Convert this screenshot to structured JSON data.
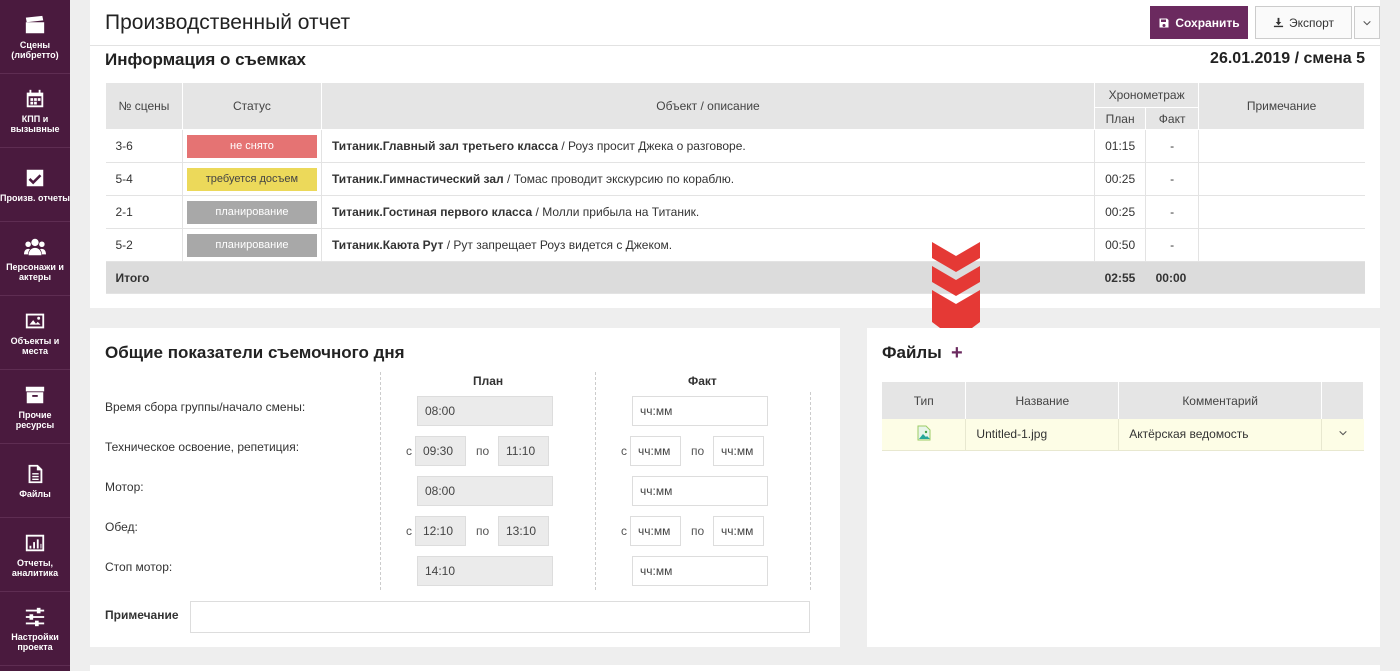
{
  "sidebar": {
    "items": [
      {
        "label": "Сцены (либретто)",
        "icon": "clapperboard-icon"
      },
      {
        "label": "КПП и вызывные",
        "icon": "calendar-icon"
      },
      {
        "label": "Произв. отчеты",
        "icon": "checkbox-icon"
      },
      {
        "label": "Персонажи и актеры",
        "icon": "people-icon"
      },
      {
        "label": "Объекты и места",
        "icon": "image-icon"
      },
      {
        "label": "Прочие ресурсы",
        "icon": "box-icon"
      },
      {
        "label": "Файлы",
        "icon": "file-icon"
      },
      {
        "label": "Отчеты, аналитика",
        "icon": "chart-icon"
      },
      {
        "label": "Настройки проекта",
        "icon": "sliders-icon"
      }
    ]
  },
  "header": {
    "title": "Производственный отчет",
    "save_label": "Сохранить",
    "export_label": "Экспорт"
  },
  "info": {
    "title": "Информация о съемках",
    "date": "26.01.2019 / смена 5",
    "columns": {
      "scene_no": "№ сцены",
      "status": "Статус",
      "object": "Объект / описание",
      "timing": "Хронометраж",
      "plan": "План",
      "fact": "Факт",
      "note": "Примечание"
    },
    "rows": [
      {
        "scene": "3-6",
        "status": "не снято",
        "status_color": "#e57373",
        "object": "Титаник.Главный зал третьего класса",
        "desc": "Роуз просит Джека о разговоре.",
        "plan": "01:15",
        "fact": "-"
      },
      {
        "scene": "5-4",
        "status": "требуется досъем",
        "status_color": "#ecd95a",
        "object": "Титаник.Гимнастический зал",
        "desc": "Томас проводит экскурсию по кораблю.",
        "plan": "00:25",
        "fact": "-"
      },
      {
        "scene": "2-1",
        "status": "планирование",
        "status_color": "#a8a8a8",
        "object": "Титаник.Гостиная первого класса",
        "desc": "Молли прибыла на Титаник.",
        "plan": "00:25",
        "fact": "-"
      },
      {
        "scene": "5-2",
        "status": "планирование",
        "status_color": "#a8a8a8",
        "object": "Титаник.Каюта Рут",
        "desc": "Рут запрещает Роуз видется с Джеком.",
        "plan": "00:50",
        "fact": "-"
      }
    ],
    "total": {
      "label": "Итого",
      "plan": "02:55",
      "fact": "00:00"
    }
  },
  "general": {
    "title": "Общие показатели съемочного дня",
    "plan_header": "План",
    "fact_header": "Факт",
    "from": "с",
    "to": "по",
    "placeholder": "чч:мм",
    "rows": [
      {
        "label": "Время сбора группы/начало смены:",
        "plan": "08:00"
      },
      {
        "label": "Техническое освоение, репетиция:",
        "plan_from": "09:30",
        "plan_to": "11:10"
      },
      {
        "label": "Мотор:",
        "plan": "08:00"
      },
      {
        "label": "Обед:",
        "plan_from": "12:10",
        "plan_to": "13:10"
      },
      {
        "label": "Стоп мотор:",
        "plan": "14:10"
      }
    ],
    "note_label": "Примечание"
  },
  "files": {
    "title": "Файлы",
    "plus": "+",
    "columns": {
      "type": "Тип",
      "name": "Название",
      "comment": "Комментарий"
    },
    "rows": [
      {
        "name": "Untitled-1.jpg",
        "comment": "Актёрская ведомость"
      }
    ]
  },
  "colors": {
    "sidebar": "#4a1a3e",
    "accent": "#6b2a5f",
    "arrow": "#e53935"
  }
}
